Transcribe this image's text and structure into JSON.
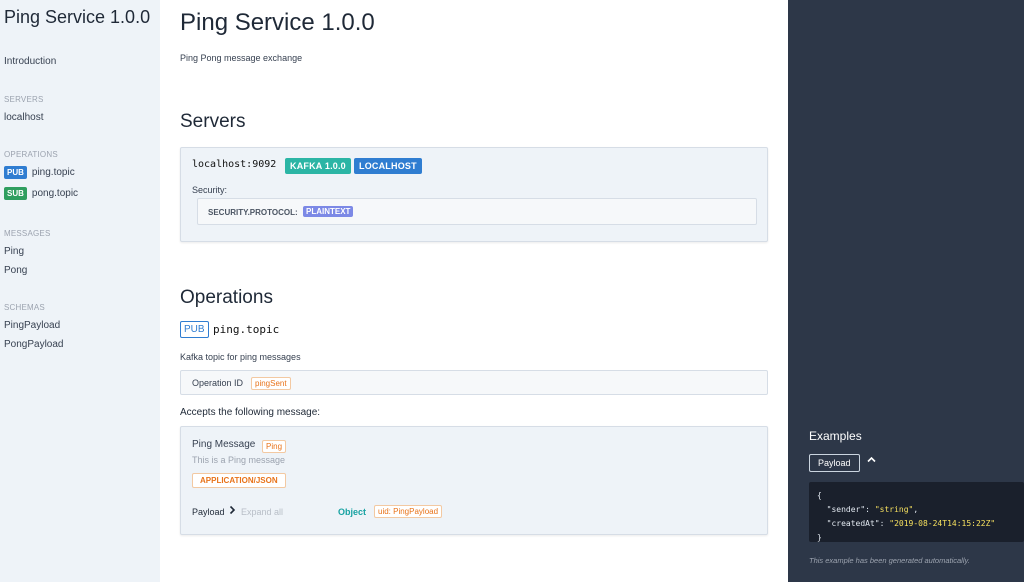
{
  "sidebar": {
    "title": "Ping Service 1.0.0",
    "introduction": "Introduction",
    "servers_heading": "SERVERS",
    "servers": [
      "localhost"
    ],
    "operations_heading": "OPERATIONS",
    "operations": [
      {
        "badge": "PUB",
        "label": "ping.topic"
      },
      {
        "badge": "SUB",
        "label": "pong.topic"
      }
    ],
    "messages_heading": "MESSAGES",
    "messages": [
      "Ping",
      "Pong"
    ],
    "schemas_heading": "SCHEMAS",
    "schemas": [
      "PingPayload",
      "PongPayload"
    ]
  },
  "main": {
    "title": "Ping Service 1.0.0",
    "description": "Ping Pong message exchange",
    "servers_heading": "Servers",
    "server": {
      "url": "localhost:9092",
      "protocol_badge": "KAFKA 1.0.0",
      "name_badge": "LOCALHOST",
      "security_label": "Security:",
      "security_key": "SECURITY.PROTOCOL:",
      "security_value": "PLAINTEXT"
    },
    "operations_heading": "Operations",
    "operation": {
      "badge": "PUB",
      "name": "ping.topic",
      "description": "Kafka topic for ping messages",
      "operation_id_label": "Operation ID",
      "operation_id": "pingSent",
      "accepts_label": "Accepts the following message:",
      "message": {
        "title": "Ping Message",
        "name_tag": "Ping",
        "description": "This is a Ping message",
        "content_type": "APPLICATION/JSON",
        "payload_label": "Payload",
        "expand_label": "Expand all",
        "type": "Object",
        "uid": "uid: PingPayload"
      }
    }
  },
  "examples": {
    "title": "Examples",
    "payload_button": "Payload",
    "code": {
      "open": "{",
      "line1_key": "\"sender\"",
      "line1_value": "\"string\"",
      "line2_key": "\"createdAt\"",
      "line2_value": "\"2019-08-24T14:15:22Z\"",
      "close": "}"
    },
    "note": "This example has been generated automatically."
  },
  "colors": {
    "pub": "#2f7dd1",
    "sub": "#2f9e5f",
    "kafka_badge": "#2bb5a5",
    "localhost_badge": "#2f7dd1",
    "plaintext_badge": "#7c89e6",
    "orange_tag": "#e8731a",
    "object_type": "#17a2a2",
    "right_panel": "#2d3748"
  }
}
